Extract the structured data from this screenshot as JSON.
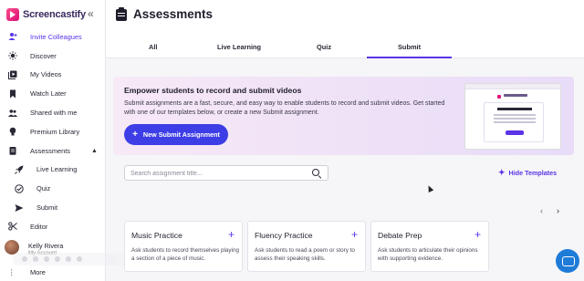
{
  "app": {
    "brand": "Screencastify"
  },
  "sidebar": {
    "items": [
      {
        "label": "Invite Colleagues",
        "icon": "user-plus-icon"
      },
      {
        "label": "Discover",
        "icon": "sun-icon"
      },
      {
        "label": "My Videos",
        "icon": "video-library-icon"
      },
      {
        "label": "Watch Later",
        "icon": "bookmark-icon"
      },
      {
        "label": "Shared with me",
        "icon": "people-icon"
      },
      {
        "label": "Premium Library",
        "icon": "lightbulb-icon"
      },
      {
        "label": "Assessments",
        "icon": "clipboard-icon"
      },
      {
        "label": "Live Learning",
        "icon": "rocket-icon"
      },
      {
        "label": "Quiz",
        "icon": "check-circle-icon"
      },
      {
        "label": "Submit",
        "icon": "send-icon"
      },
      {
        "label": "Editor",
        "icon": "scissors-icon"
      }
    ],
    "user": {
      "name": "Kelly Rivera",
      "sub": "My Account"
    },
    "more": "More"
  },
  "header": {
    "title": "Assessments"
  },
  "tabs": [
    "All",
    "Live Learning",
    "Quiz",
    "Submit"
  ],
  "active_tab": "Submit",
  "banner": {
    "title": "Empower students to record and submit videos",
    "text": "Submit assignments are a fast, secure, and easy way to enable students to record and submit videos. Get started with one of our templates below, or create a new Submit assignment.",
    "button": "New Submit Assignment"
  },
  "search": {
    "placeholder": "Search assignment title..."
  },
  "hide_templates": "Hide Templates",
  "templates": [
    {
      "title": "Music Practice",
      "desc": "Ask students to record themselves playing a section of a piece of music."
    },
    {
      "title": "Fluency Practice",
      "desc": "Ask students to read a poem or story to assess their speaking skills."
    },
    {
      "title": "Debate Prep",
      "desc": "Ask students to articulate their opinions with supporting evidence."
    }
  ],
  "colors": {
    "accent": "#5b34e8",
    "button": "#3d3ee6",
    "brand": "#e2157d"
  }
}
